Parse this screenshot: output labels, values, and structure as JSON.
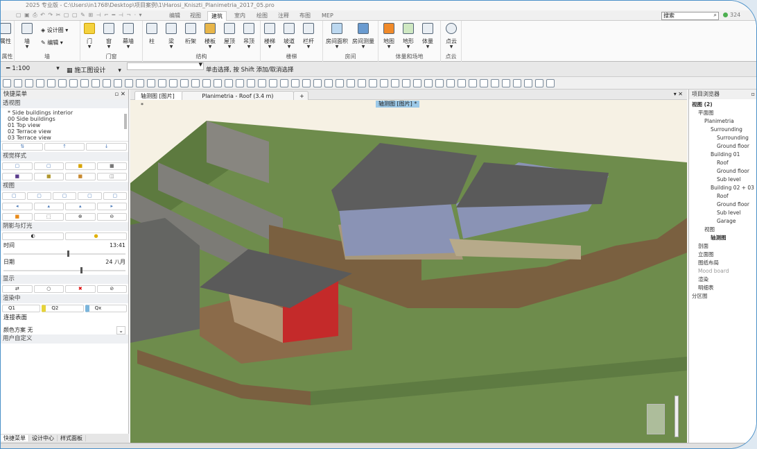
{
  "title": "2025 专业版 - C:\\Users\\in1768\\Desktop\\项目案例\\1\\Harosi_Kniszti_Planimetria_2017_05.pro",
  "menu_tabs": [
    "编辑",
    "视图",
    "建筑",
    "室内",
    "绘图",
    "注释",
    "布图",
    "MEP"
  ],
  "active_tab": "建筑",
  "search": {
    "placeholder": "搜索",
    "count": "324"
  },
  "ribbon": {
    "groups": [
      {
        "label": "属性",
        "buttons": [
          "属性"
        ]
      },
      {
        "label": "墙",
        "buttons": [
          "墙"
        ],
        "small": [
          "设计圈",
          "编辑"
        ]
      },
      {
        "label": "门窗",
        "buttons": [
          "门",
          "窗",
          "幕墙"
        ]
      },
      {
        "label": "结构",
        "buttons": [
          "柱",
          "梁",
          "桁架",
          "楼板",
          "屋顶",
          "吊顶"
        ]
      },
      {
        "label": "楼梯",
        "buttons": [
          "楼梯",
          "坡道",
          "栏杆"
        ]
      },
      {
        "label": "房间",
        "buttons": [
          "房间面积",
          "房间测量"
        ]
      },
      {
        "label": "体量和场地",
        "buttons": [
          "地图",
          "地形",
          "体量"
        ]
      },
      {
        "label": "点云",
        "buttons": [
          "点云"
        ]
      }
    ]
  },
  "toolbar": {
    "scale": "1:100",
    "design_mode": "施工图设计",
    "hint": "单击选择, 按 Shift 添加/取消选择"
  },
  "left_panel": {
    "title": "快捷菜单",
    "perspective": {
      "label": "透视图",
      "items": [
        "* Side buildings interior",
        "00 Side buildings",
        "01 Top view",
        "02 Terrace view",
        "03 Terrace view"
      ]
    },
    "visual_style": "视觉样式",
    "view": "视图",
    "shadow_light": "阴影与灯光",
    "time": {
      "label": "时间",
      "value": "13:41",
      "fraction": 0.52
    },
    "date": {
      "label": "日期",
      "value": "24 八月",
      "fraction": 0.63
    },
    "display": "显示",
    "rendering": "渲染中",
    "quality": [
      "Q1",
      "Q2",
      "Qx"
    ],
    "connect_surface": "连接表面",
    "color_scheme": {
      "label": "颜色方案",
      "value": "无"
    },
    "user_defined": "用户自定义",
    "bottom_tabs": [
      "快捷菜单",
      "设计中心",
      "样式面板"
    ]
  },
  "viewport": {
    "tabs": [
      "轴测图 [图片] *",
      "Planimetria - Roof (3.4 m)",
      "+"
    ],
    "view_label": "轴测图 [图片] *"
  },
  "project_browser": {
    "title": "项目浏览器",
    "tree": [
      {
        "label": "视图 (2)",
        "level": 0,
        "bold": true
      },
      {
        "label": "平面图",
        "level": 1
      },
      {
        "label": "Planimetria",
        "level": 2
      },
      {
        "label": "Surrounding",
        "level": 3
      },
      {
        "label": "Surrounding",
        "level": 4
      },
      {
        "label": "Ground floor",
        "level": 4
      },
      {
        "label": "Building 01",
        "level": 3
      },
      {
        "label": "Roof",
        "level": 4
      },
      {
        "label": "Ground floor",
        "level": 4
      },
      {
        "label": "Sub level",
        "level": 4
      },
      {
        "label": "Building 02 + 03",
        "level": 3
      },
      {
        "label": "Roof",
        "level": 4
      },
      {
        "label": "Ground floor",
        "level": 4
      },
      {
        "label": "Sub level",
        "level": 4
      },
      {
        "label": "Garage",
        "level": 4
      },
      {
        "label": "视图",
        "level": 2
      },
      {
        "label": "轴测图",
        "level": 3,
        "bold": true
      },
      {
        "label": "剖面",
        "level": 1
      },
      {
        "label": "立面图",
        "level": 1
      },
      {
        "label": "图纸布局",
        "level": 1
      },
      {
        "label": "Mood board",
        "level": 1,
        "muted": true
      },
      {
        "label": "渲染",
        "level": 1
      },
      {
        "label": "明细表",
        "level": 1
      },
      {
        "label": "分区图",
        "level": 0
      }
    ]
  }
}
